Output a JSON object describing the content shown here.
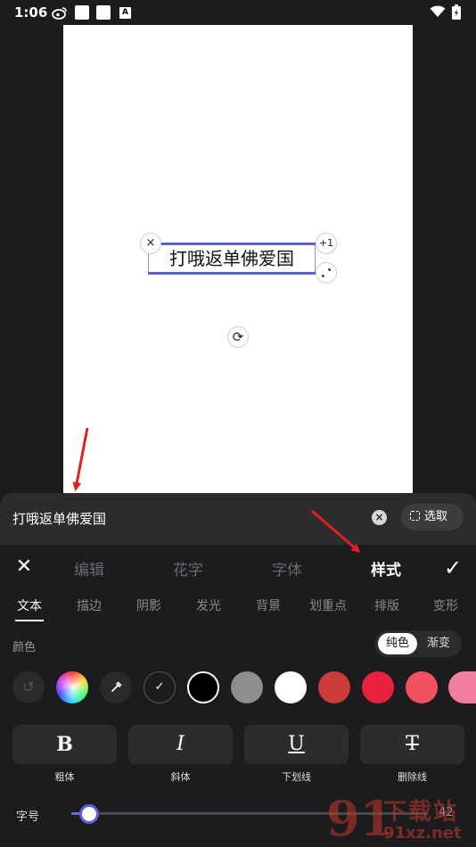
{
  "status_bar": {
    "time": "1:06",
    "icons": [
      "weibo-icon",
      "notification-square-icon",
      "notification-square-icon",
      "a-badge-icon",
      "wifi-icon",
      "battery-icon"
    ],
    "badge_letter": "A"
  },
  "canvas": {
    "text": "打哦返单佛爱国",
    "handles": {
      "delete": "×",
      "plus_one": "+1",
      "rotate": "⟳"
    }
  },
  "input_bar": {
    "text": "打哦返单佛爱国",
    "clear": "×",
    "select_label": "选取"
  },
  "tabs": [
    "编辑",
    "花字",
    "字体",
    "样式"
  ],
  "active_tab": "样式",
  "sub_tabs": [
    "文本",
    "描边",
    "阴影",
    "发光",
    "背景",
    "划重点",
    "排版",
    "变形"
  ],
  "active_sub_tab": "文本",
  "color_section": {
    "label": "颜色",
    "modes": [
      "纯色",
      "渐变"
    ],
    "active_mode": "纯色",
    "swatches": [
      "#1c1c1e",
      "#000000",
      "#8e8e8e",
      "#ffffff",
      "#cc3b3b",
      "#e8213f",
      "#f2525f",
      "#f47ea0"
    ],
    "selected_swatch": "#000000"
  },
  "style_buttons": [
    {
      "glyph": "B",
      "label": "粗体"
    },
    {
      "glyph": "I",
      "label": "斜体"
    },
    {
      "glyph": "U",
      "label": "下划线"
    },
    {
      "glyph": "T",
      "label": "删除线"
    }
  ],
  "font_size": {
    "label": "字号",
    "value": "42",
    "level": 0.05
  },
  "watermark": {
    "mark": "91",
    "title": "下载站",
    "site": "91xz.net"
  },
  "colors": {
    "accent": "#5a60d8",
    "annotation": "#e02020",
    "background": "#1c1c1e"
  }
}
